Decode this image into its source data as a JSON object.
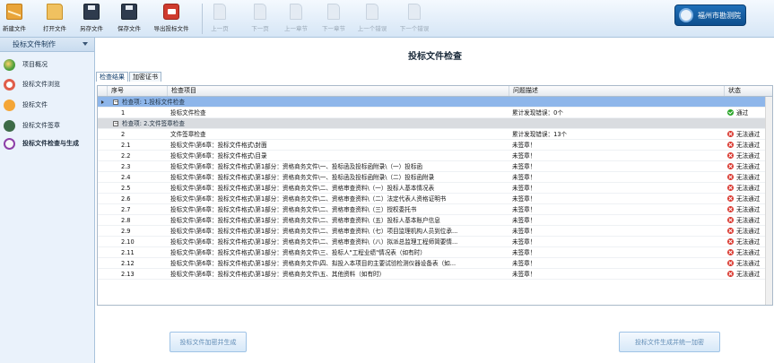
{
  "toolbar": {
    "buttons": [
      {
        "label": "新建文件",
        "icon": "new-file-icon",
        "enabled": true
      },
      {
        "label": "打开文件",
        "icon": "open-folder-icon",
        "enabled": true
      },
      {
        "label": "另存文件",
        "icon": "save-as-icon",
        "enabled": true
      },
      {
        "label": "保存文件",
        "icon": "save-icon",
        "enabled": true
      },
      {
        "label": "导出投标文件",
        "icon": "export-icon",
        "enabled": true
      },
      {
        "label": "上一页",
        "icon": "doc-icon",
        "enabled": false
      },
      {
        "label": "下一页",
        "icon": "doc-icon",
        "enabled": false
      },
      {
        "label": "上一章节",
        "icon": "doc-icon",
        "enabled": false
      },
      {
        "label": "下一章节",
        "icon": "doc-icon",
        "enabled": false
      },
      {
        "label": "上一个错误",
        "icon": "doc-icon",
        "enabled": false
      },
      {
        "label": "下一个错误",
        "icon": "doc-icon",
        "enabled": false
      }
    ],
    "logo_text": "福州市勘测院"
  },
  "sidebar": {
    "title": "投标文件制作",
    "items": [
      {
        "label": "项目概况",
        "icon": "project-overview-icon"
      },
      {
        "label": "投标文件浏览",
        "icon": "browse-icon"
      },
      {
        "label": "投标文件",
        "icon": "document-icon"
      },
      {
        "label": "投标文件签章",
        "icon": "signature-icon"
      },
      {
        "label": "投标文件检查与生成",
        "icon": "check-generate-icon",
        "active": true
      }
    ]
  },
  "main": {
    "title": "投标文件检查",
    "tabs": [
      {
        "label": "检查结果",
        "active": true
      },
      {
        "label": "加密证书",
        "active": false
      }
    ],
    "columns": [
      "序号",
      "检查项目",
      "问题描述",
      "状态"
    ],
    "groups": [
      {
        "label": "检查项: 1.投标文件检查",
        "rows": [
          {
            "no": "1",
            "item": "投标文件检查",
            "desc": "累计发现错误：0个",
            "status": "通过",
            "ok": true
          }
        ]
      },
      {
        "label": "检查项: 2.文件签章检查",
        "rows": [
          {
            "no": "2",
            "item": "文件签章检查",
            "desc": "累计发现错误：13个",
            "status": "无法通过",
            "ok": false
          },
          {
            "no": "2.1",
            "item": "投标文件\\第6章：投标文件格式\\封面",
            "desc": "未签章！",
            "status": "无法通过",
            "ok": false
          },
          {
            "no": "2.2",
            "item": "投标文件\\第6章：投标文件格式\\目录",
            "desc": "未签章！",
            "status": "无法通过",
            "ok": false
          },
          {
            "no": "2.3",
            "item": "投标文件\\第6章：投标文件格式\\第1部分：资格商务文件\\一、投标函及投标函附录\\（一）投标函",
            "desc": "未签章！",
            "status": "无法通过",
            "ok": false
          },
          {
            "no": "2.4",
            "item": "投标文件\\第6章：投标文件格式\\第1部分：资格商务文件\\一、投标函及投标函附录\\（二）投标函附录",
            "desc": "未签章！",
            "status": "无法通过",
            "ok": false
          },
          {
            "no": "2.5",
            "item": "投标文件\\第6章：投标文件格式\\第1部分：资格商务文件\\二、资格审查资料\\（一）投标人基本情况表",
            "desc": "未签章！",
            "status": "无法通过",
            "ok": false
          },
          {
            "no": "2.6",
            "item": "投标文件\\第6章：投标文件格式\\第1部分：资格商务文件\\二、资格审查资料\\（二）法定代表人资格证明书",
            "desc": "未签章！",
            "status": "无法通过",
            "ok": false
          },
          {
            "no": "2.7",
            "item": "投标文件\\第6章：投标文件格式\\第1部分：资格商务文件\\二、资格审查资料\\（三）授权委托书",
            "desc": "未签章！",
            "status": "无法通过",
            "ok": false
          },
          {
            "no": "2.8",
            "item": "投标文件\\第6章：投标文件格式\\第1部分：资格商务文件\\二、资格审查资料\\（五）投标人基本账户信息",
            "desc": "未签章！",
            "status": "无法通过",
            "ok": false
          },
          {
            "no": "2.9",
            "item": "投标文件\\第6章：投标文件格式\\第1部分：资格商务文件\\二、资格审查资料\\（七）项目监理机构人员到位承...",
            "desc": "未签章！",
            "status": "无法通过",
            "ok": false
          },
          {
            "no": "2.10",
            "item": "投标文件\\第6章：投标文件格式\\第1部分：资格商务文件\\二、资格审查资料\\（八）拟派总监理工程师简要情...",
            "desc": "未签章！",
            "status": "无法通过",
            "ok": false
          },
          {
            "no": "2.11",
            "item": "投标文件\\第6章：投标文件格式\\第1部分：资格商务文件\\三、投标人\"工程业绩\"情况表（如有时）",
            "desc": "未签章！",
            "status": "无法通过",
            "ok": false
          },
          {
            "no": "2.12",
            "item": "投标文件\\第6章：投标文件格式\\第1部分：资格商务文件\\四、拟投入本项目的主要试验检测仪器设备表（如...",
            "desc": "未签章！",
            "status": "无法通过",
            "ok": false
          },
          {
            "no": "2.13",
            "item": "投标文件\\第6章：投标文件格式\\第1部分：资格商务文件\\五、其他资料（如有时）",
            "desc": "未签章！",
            "status": "无法通过",
            "ok": false
          }
        ]
      }
    ],
    "button_left": "投标文件加密并生成",
    "button_right": "投标文件生成并统一加密"
  }
}
